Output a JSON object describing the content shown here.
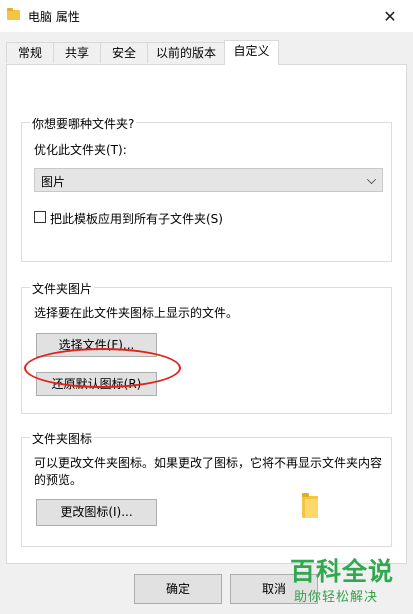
{
  "window": {
    "title": "电脑 属性"
  },
  "tabs": [
    {
      "label": "常规"
    },
    {
      "label": "共享"
    },
    {
      "label": "安全"
    },
    {
      "label": "以前的版本"
    },
    {
      "label": "自定义"
    }
  ],
  "optimize_group": {
    "title": "你想要哪种文件夹?",
    "optimize_label": "优化此文件夹(T):",
    "optimize_value": "图片",
    "apply_checkbox_label": "把此模板应用到所有子文件夹(S)"
  },
  "picture_group": {
    "title": "文件夹图片",
    "description": "选择要在此文件夹图标上显示的文件。",
    "choose_file_button": "选择文件(F)...",
    "restore_default_button": "还原默认图标(R)"
  },
  "icon_group": {
    "title": "文件夹图标",
    "description_line1": "可以更改文件夹图标。如果更改了图标，它将不再显示文件夹内容",
    "description_line2": "的预览。",
    "change_icon_button": "更改图标(I)..."
  },
  "footer": {
    "ok_button": "确定",
    "cancel_button": "取消"
  },
  "watermark": {
    "title": "百科全说",
    "subtitle": "助你轻松解决"
  }
}
